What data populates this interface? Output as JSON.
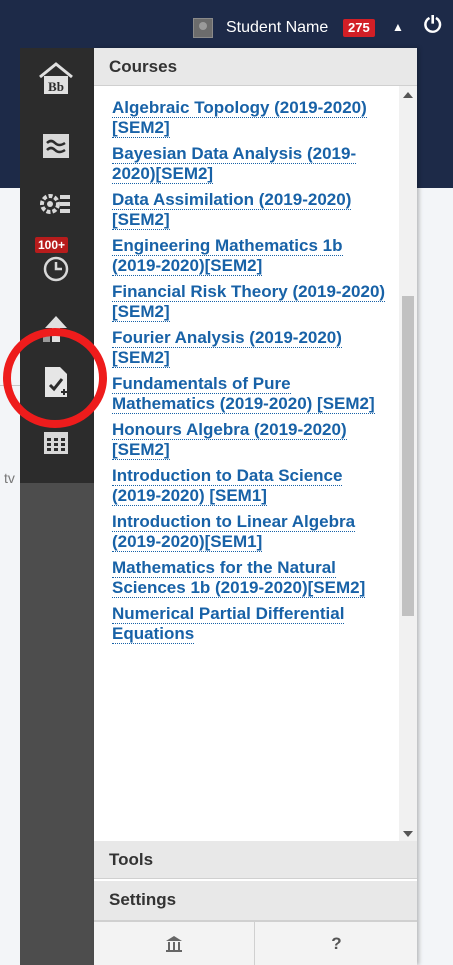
{
  "topbar": {
    "username": "Student Name",
    "notification_count": "275",
    "caret": "▲",
    "power": "⏻"
  },
  "icons": {
    "home": "home-bb-icon",
    "stream": "activity-stream-icon",
    "org": "organizations-icon",
    "due": "due-dates-icon",
    "grades": "grades-icon",
    "assignments": "assignments-icon",
    "calendar": "calendar-icon",
    "due_badge": "100+"
  },
  "panel": {
    "courses_header": "Courses",
    "courses": [
      "Algebraic Topology (2019-2020)[SEM2]",
      "Bayesian Data Analysis (2019-2020)[SEM2]",
      "Data Assimilation (2019-2020)[SEM2]",
      "Engineering Mathematics 1b (2019-2020)[SEM2]",
      "Financial Risk Theory (2019-2020)[SEM2]",
      "Fourier Analysis (2019-2020)[SEM2]",
      "Fundamentals of Pure Mathematics (2019-2020) [SEM2]",
      "Honours Algebra (2019-2020)[SEM2]",
      "Introduction to Data Science (2019-2020) [SEM1]",
      "Introduction to Linear Algebra (2019-2020)[SEM1]",
      "Mathematics for the Natural Sciences 1b (2019-2020)[SEM2]",
      "Numerical Partial Differential Equations"
    ],
    "tools_header": "Tools",
    "settings_header": "Settings",
    "bottom_left": "⌂",
    "bottom_right": "?"
  },
  "background": {
    "fragment": "tv"
  },
  "colors": {
    "topbar": "#1d2a48",
    "icon_column": "#2c2c2c",
    "link": "#1862a7",
    "badge": "#d21f26",
    "annotation": "#ee1c1c"
  }
}
